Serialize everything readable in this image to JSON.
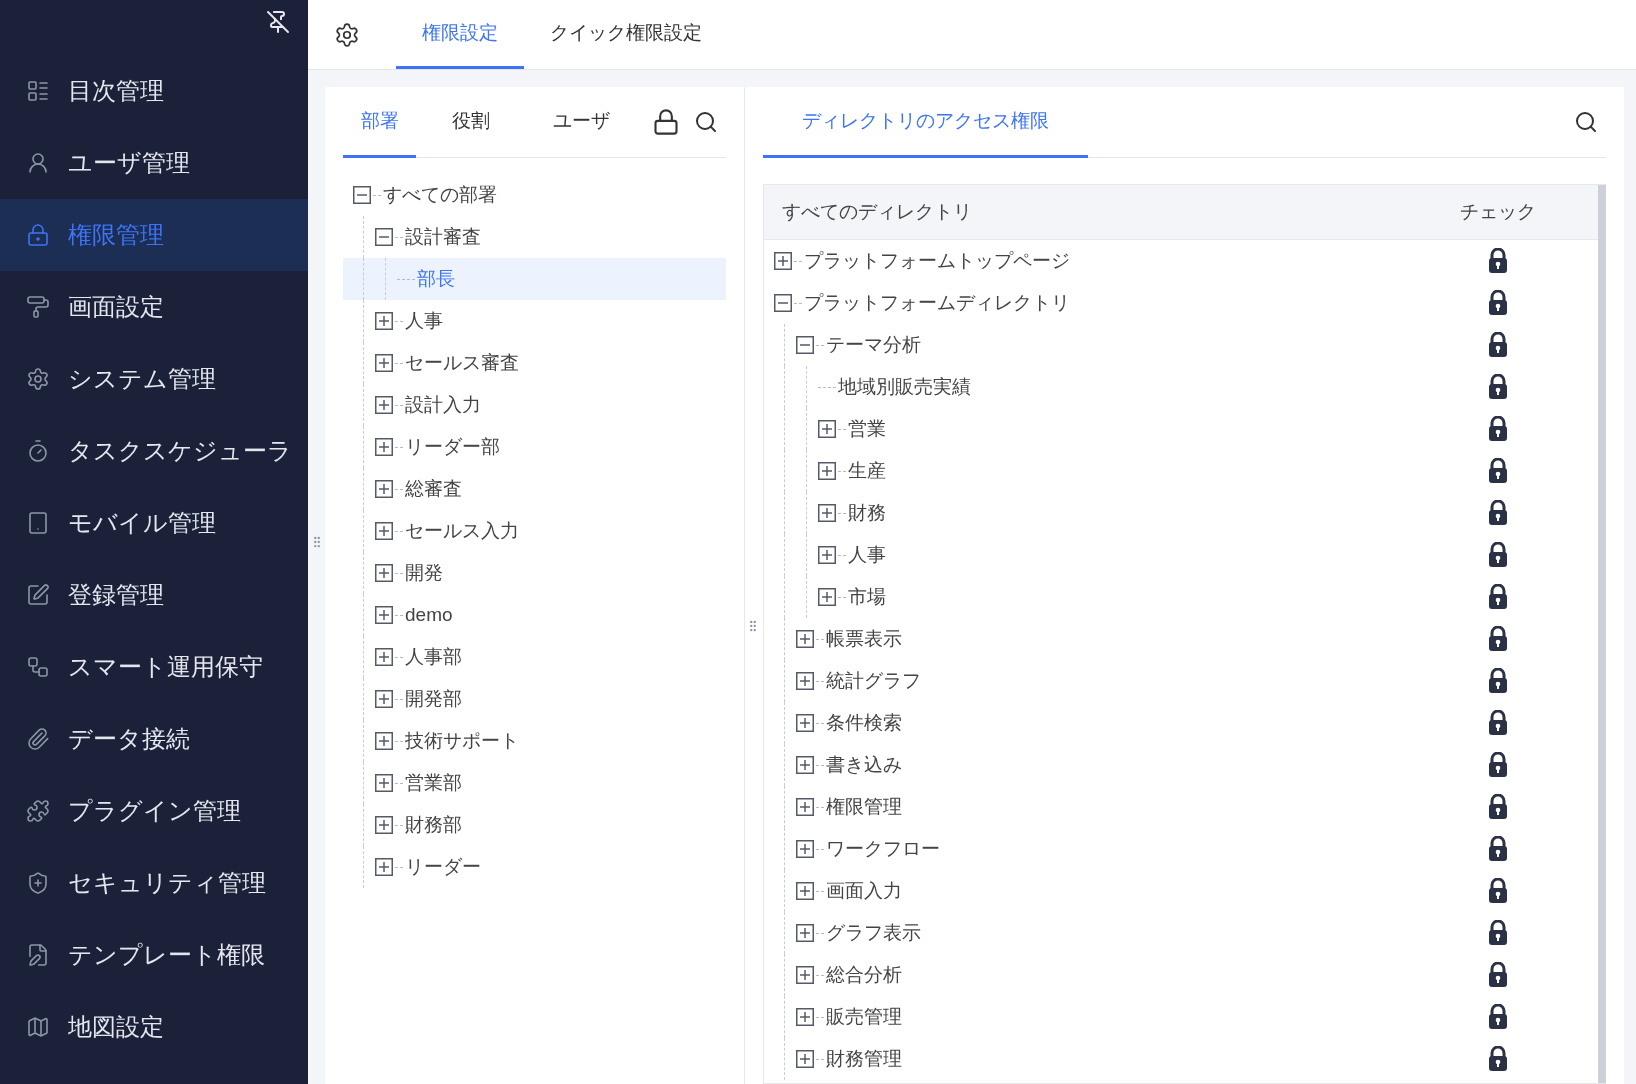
{
  "sidebar": {
    "items": [
      {
        "label": "目次管理",
        "selected": false
      },
      {
        "label": "ユーザ管理",
        "selected": false
      },
      {
        "label": "権限管理",
        "selected": true
      },
      {
        "label": "画面設定",
        "selected": false
      },
      {
        "label": "システム管理",
        "selected": false
      },
      {
        "label": "タスクスケジューラ",
        "selected": false
      },
      {
        "label": "モバイル管理",
        "selected": false
      },
      {
        "label": "登録管理",
        "selected": false
      },
      {
        "label": "スマート運用保守",
        "selected": false
      },
      {
        "label": "データ接続",
        "selected": false
      },
      {
        "label": "プラグイン管理",
        "selected": false
      },
      {
        "label": "セキュリティ管理",
        "selected": false
      },
      {
        "label": "テンプレート権限",
        "selected": false
      },
      {
        "label": "地図設定",
        "selected": false
      }
    ]
  },
  "top_tabs": [
    {
      "label": "権限設定",
      "selected": true
    },
    {
      "label": "クイック権限設定",
      "selected": false
    }
  ],
  "left_panel": {
    "tabs": [
      {
        "label": "部署",
        "selected": true
      },
      {
        "label": "役割",
        "selected": false
      },
      {
        "label": "ユーザ",
        "selected": false
      }
    ],
    "tree": [
      {
        "label": "すべての部署",
        "expanded": true,
        "selected": false,
        "children": [
          {
            "label": "設計審査",
            "expanded": true,
            "selected": false,
            "children": [
              {
                "label": "部長",
                "selected": true
              }
            ]
          },
          {
            "label": "人事",
            "expanded": false,
            "selected": false
          },
          {
            "label": "セールス審査",
            "expanded": false,
            "selected": false
          },
          {
            "label": "設計入力",
            "expanded": false,
            "selected": false
          },
          {
            "label": "リーダー部",
            "expanded": false,
            "selected": false
          },
          {
            "label": "総審査",
            "expanded": false,
            "selected": false
          },
          {
            "label": "セールス入力",
            "expanded": false,
            "selected": false
          },
          {
            "label": "開発",
            "expanded": false,
            "selected": false
          },
          {
            "label": "demo",
            "expanded": false,
            "selected": false
          },
          {
            "label": "人事部",
            "expanded": false,
            "selected": false
          },
          {
            "label": "開発部",
            "expanded": false,
            "selected": false
          },
          {
            "label": "技術サポート",
            "expanded": false,
            "selected": false
          },
          {
            "label": "営業部",
            "expanded": false,
            "selected": false
          },
          {
            "label": "財務部",
            "expanded": false,
            "selected": false
          },
          {
            "label": "リーダー",
            "expanded": false,
            "selected": false
          }
        ]
      }
    ]
  },
  "right_panel": {
    "tab": {
      "label": "ディレクトリのアクセス権限",
      "selected": true
    },
    "columns": [
      "すべてのディレクトリ",
      "チェック"
    ],
    "tree": [
      {
        "label": "プラットフォームトップページ",
        "expanded": false,
        "locked": true
      },
      {
        "label": "プラットフォームディレクトリ",
        "expanded": true,
        "locked": true,
        "children": [
          {
            "label": "テーマ分析",
            "expanded": true,
            "locked": true,
            "children": [
              {
                "label": "地域別販売実績",
                "locked": true
              },
              {
                "label": "営業",
                "expanded": false,
                "locked": true
              },
              {
                "label": "生産",
                "expanded": false,
                "locked": true
              },
              {
                "label": "財務",
                "expanded": false,
                "locked": true
              },
              {
                "label": "人事",
                "expanded": false,
                "locked": true
              },
              {
                "label": "市場",
                "expanded": false,
                "locked": true
              }
            ]
          },
          {
            "label": "帳票表示",
            "expanded": false,
            "locked": true
          },
          {
            "label": "統計グラフ",
            "expanded": false,
            "locked": true
          },
          {
            "label": "条件検索",
            "expanded": false,
            "locked": true
          },
          {
            "label": "書き込み",
            "expanded": false,
            "locked": true
          },
          {
            "label": "権限管理",
            "expanded": false,
            "locked": true
          },
          {
            "label": "ワークフロー",
            "expanded": false,
            "locked": true
          },
          {
            "label": "画面入力",
            "expanded": false,
            "locked": true
          },
          {
            "label": "グラフ表示",
            "expanded": false,
            "locked": true
          },
          {
            "label": "総合分析",
            "expanded": false,
            "locked": true
          },
          {
            "label": "販売管理",
            "expanded": false,
            "locked": true
          },
          {
            "label": "財務管理",
            "expanded": false,
            "locked": true
          }
        ]
      }
    ]
  }
}
